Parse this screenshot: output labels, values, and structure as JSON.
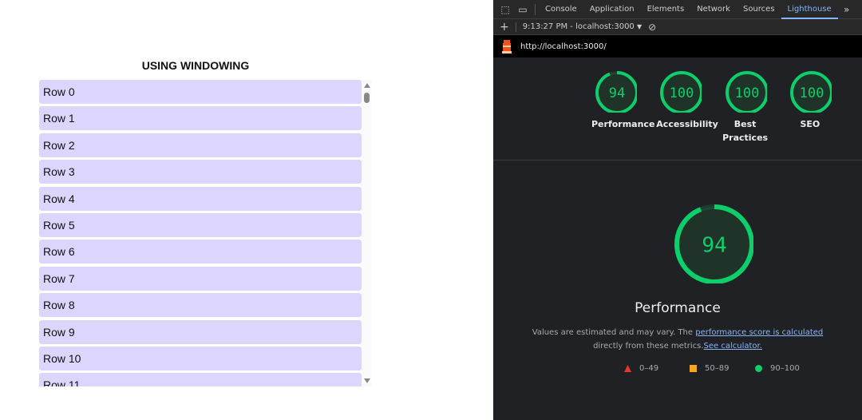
{
  "page": {
    "title": "USING WINDOWING",
    "rows": [
      "Row 0",
      "Row 1",
      "Row 2",
      "Row 3",
      "Row 4",
      "Row 5",
      "Row 6",
      "Row 7",
      "Row 8",
      "Row 9",
      "Row 10",
      "Row 11"
    ]
  },
  "devtools": {
    "tabs": [
      "Console",
      "Application",
      "Elements",
      "Network",
      "Sources",
      "Lighthouse"
    ],
    "active_tab": "Lighthouse",
    "report_select": "9:13:27 PM - localhost:3000",
    "url": "http://localhost:3000/",
    "scores": [
      {
        "label": "Performance",
        "value": 94
      },
      {
        "label": "Accessibility",
        "value": 100
      },
      {
        "label": "Best Practices",
        "value": 100
      },
      {
        "label": "SEO",
        "value": 100
      }
    ],
    "main": {
      "value": 94,
      "title": "Performance",
      "desc1": "Values are estimated and may vary. The ",
      "link1": "performance score is calculated",
      "desc2": "directly from these metrics.",
      "link2": "See calculator."
    },
    "legend": [
      {
        "label": "0–49",
        "color": "#e33b2e"
      },
      {
        "label": "50–89",
        "color": "#f5a623"
      },
      {
        "label": "90–100",
        "color": "#0cce6b"
      }
    ],
    "colors": {
      "pass": "#0cce6b",
      "row_bg": "#dcd6fe"
    }
  }
}
